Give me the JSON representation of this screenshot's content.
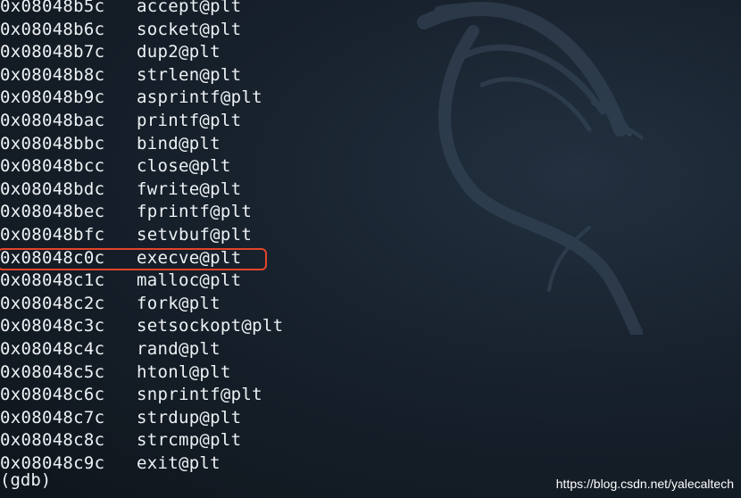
{
  "terminal": {
    "rows": [
      {
        "address": "0x08048b5c",
        "symbol": "accept@plt"
      },
      {
        "address": "0x08048b6c",
        "symbol": "socket@plt"
      },
      {
        "address": "0x08048b7c",
        "symbol": "dup2@plt"
      },
      {
        "address": "0x08048b8c",
        "symbol": "strlen@plt"
      },
      {
        "address": "0x08048b9c",
        "symbol": "asprintf@plt"
      },
      {
        "address": "0x08048bac",
        "symbol": "printf@plt"
      },
      {
        "address": "0x08048bbc",
        "symbol": "bind@plt"
      },
      {
        "address": "0x08048bcc",
        "symbol": "close@plt"
      },
      {
        "address": "0x08048bdc",
        "symbol": "fwrite@plt"
      },
      {
        "address": "0x08048bec",
        "symbol": "fprintf@plt"
      },
      {
        "address": "0x08048bfc",
        "symbol": "setvbuf@plt"
      },
      {
        "address": "0x08048c0c",
        "symbol": "execve@plt"
      },
      {
        "address": "0x08048c1c",
        "symbol": "malloc@plt"
      },
      {
        "address": "0x08048c2c",
        "symbol": "fork@plt"
      },
      {
        "address": "0x08048c3c",
        "symbol": "setsockopt@plt"
      },
      {
        "address": "0x08048c4c",
        "symbol": "rand@plt"
      },
      {
        "address": "0x08048c5c",
        "symbol": "htonl@plt"
      },
      {
        "address": "0x08048c6c",
        "symbol": "snprintf@plt"
      },
      {
        "address": "0x08048c7c",
        "symbol": "strdup@plt"
      },
      {
        "address": "0x08048c8c",
        "symbol": "strcmp@plt"
      },
      {
        "address": "0x08048c9c",
        "symbol": "exit@plt"
      }
    ],
    "highlighted_index": 11,
    "prompt": "(gdb)"
  },
  "watermark": "https://blog.csdn.net/yalecaltech",
  "colors": {
    "text": "#eef2f5",
    "highlight": "#e2452b",
    "background": "#17212c"
  },
  "icons": {
    "background_logo": "kali-dragon-icon"
  }
}
